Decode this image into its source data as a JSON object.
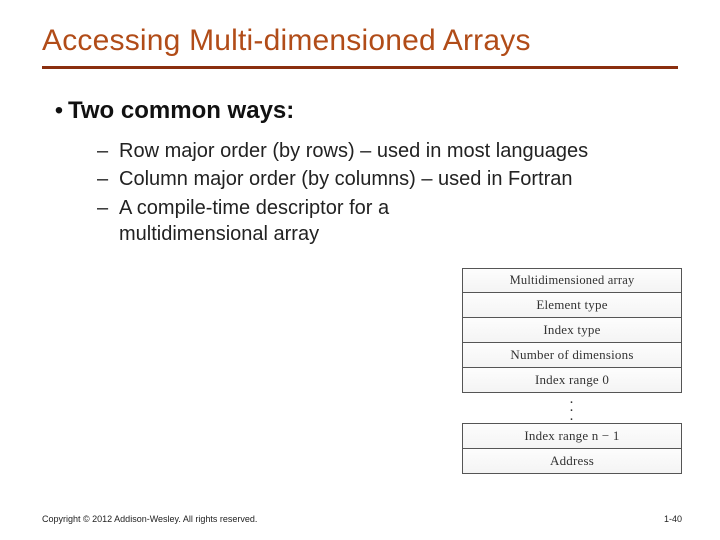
{
  "title": "Accessing Multi-dimensioned Arrays",
  "bullet": "Two common ways:",
  "sub": {
    "a": "Row major order (by rows) – used in most languages",
    "b": "Column major order (by columns) – used in Fortran",
    "c": "A compile-time descriptor for a multidimensional array"
  },
  "descriptor": {
    "r0": "Multidimensioned array",
    "r1": "Element type",
    "r2": "Index type",
    "r3": "Number of dimensions",
    "r4": "Index range 0",
    "r5": "Index range n − 1",
    "r6": "Address"
  },
  "footer": "Copyright © 2012 Addison-Wesley. All rights reserved.",
  "page": "1-40"
}
